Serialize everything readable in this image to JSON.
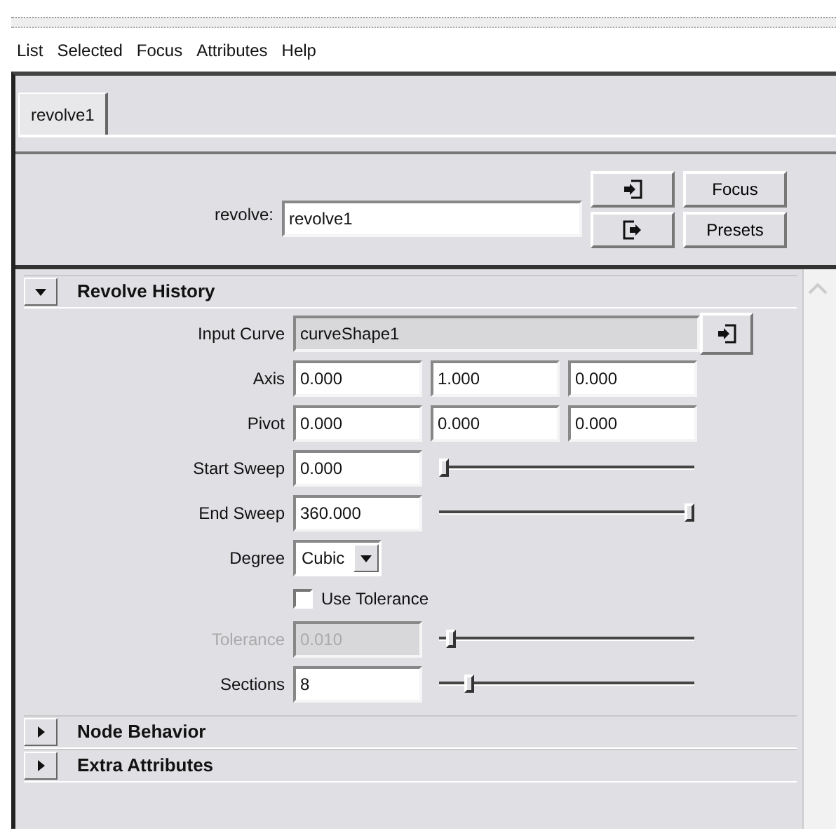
{
  "menu": [
    "List",
    "Selected",
    "Focus",
    "Attributes",
    "Help"
  ],
  "tabs": [
    {
      "label": "revolve1",
      "selected": true
    }
  ],
  "node": {
    "label": "revolve:",
    "value": "revolve1"
  },
  "buttons": [
    "Focus",
    "Presets"
  ],
  "sections": [
    {
      "title": "Revolve History",
      "expanded": true,
      "rows": [
        {
          "kind": "connection",
          "label": "Input Curve",
          "value": "curveShape1"
        },
        {
          "kind": "vector",
          "label": "Axis",
          "values": [
            "0.000",
            "1.000",
            "0.000"
          ]
        },
        {
          "kind": "vector",
          "label": "Pivot",
          "values": [
            "0.000",
            "0.000",
            "0.000"
          ]
        },
        {
          "kind": "slider",
          "label": "Start Sweep",
          "value": "0.000",
          "level": 0,
          "disabled": false
        },
        {
          "kind": "slider",
          "label": "End Sweep",
          "value": "360.000",
          "level": 1,
          "disabled": false
        },
        {
          "kind": "dropdown",
          "label": "Degree",
          "value": "Cubic"
        },
        {
          "kind": "checkbox",
          "label": "Use Tolerance",
          "checked": false
        },
        {
          "kind": "slider",
          "label": "Tolerance",
          "value": "0.010",
          "level": 0.03,
          "disabled": true
        },
        {
          "kind": "slider",
          "label": "Sections",
          "value": "8",
          "level": 0.1,
          "disabled": false
        }
      ]
    },
    {
      "title": "Node Behavior",
      "expanded": false
    },
    {
      "title": "Extra Attributes",
      "expanded": false
    }
  ]
}
